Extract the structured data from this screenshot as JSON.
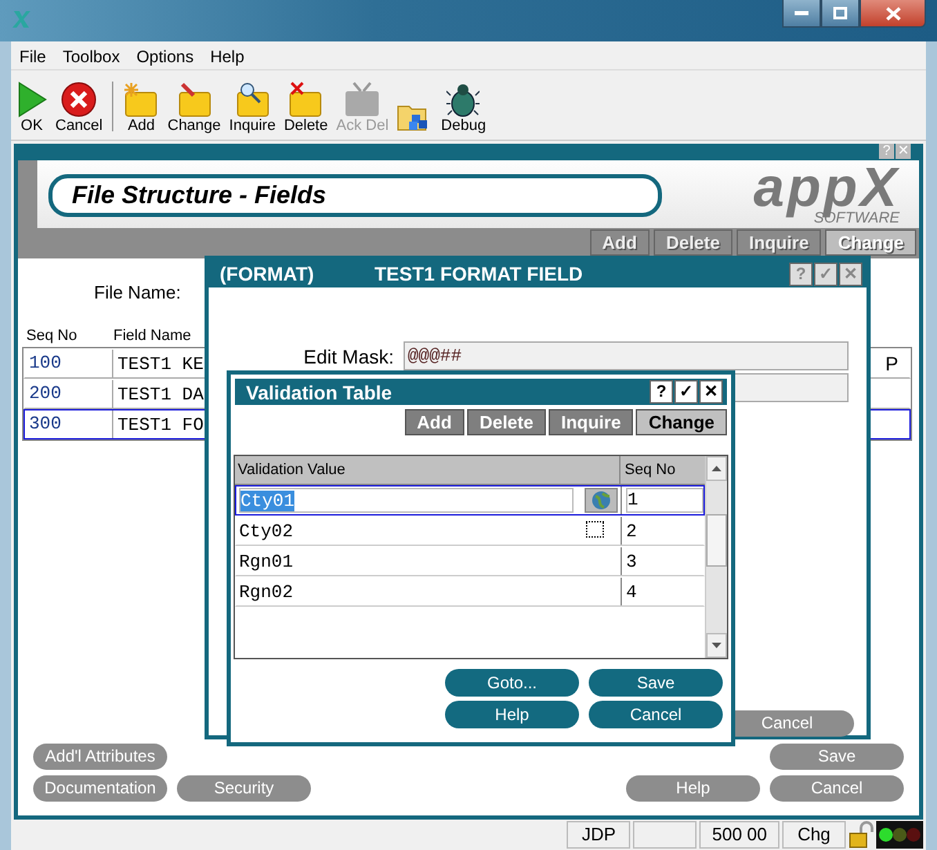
{
  "menu": [
    {
      "label": "File"
    },
    {
      "label": "Toolbox"
    },
    {
      "label": "Options"
    },
    {
      "label": "Help"
    }
  ],
  "toolbar": [
    {
      "kind": "ok",
      "label": "OK",
      "disabled": false
    },
    {
      "kind": "cancel",
      "label": "Cancel",
      "disabled": false
    },
    {
      "kind": "add",
      "label": "Add",
      "disabled": false
    },
    {
      "kind": "change",
      "label": "Change",
      "disabled": false
    },
    {
      "kind": "inquire",
      "label": "Inquire",
      "disabled": false
    },
    {
      "kind": "delete",
      "label": "Delete",
      "disabled": false
    },
    {
      "kind": "ackdel",
      "label": "Ack Del",
      "disabled": true
    },
    {
      "kind": "folder"
    },
    {
      "kind": "debug",
      "label": "Debug",
      "disabled": false
    }
  ],
  "screen": {
    "controls": [
      "?",
      "✕"
    ],
    "title": "File Structure - Fields",
    "logo": "appX",
    "logo_sub": "SOFTWARE",
    "actions": [
      {
        "label": "Add",
        "selected": false
      },
      {
        "label": "Delete",
        "selected": false
      },
      {
        "label": "Inquire",
        "selected": false
      },
      {
        "label": "Change",
        "selected": true
      }
    ],
    "file_name_label": "File Name:",
    "columns": [
      "Seq No",
      "Field Name"
    ],
    "rows": [
      {
        "seq": "100",
        "name": "TEST1 KE",
        "flag": "P",
        "selected": false
      },
      {
        "seq": "200",
        "name": "TEST1 DA",
        "selected": false
      },
      {
        "seq": "300",
        "name": "TEST1 FO",
        "selected": true
      }
    ],
    "buttons_left": [
      [
        "Add'l Attributes"
      ],
      [
        "Documentation",
        "Security"
      ]
    ],
    "buttons_right": [
      [
        "Save"
      ],
      [
        "Help",
        "Cancel"
      ]
    ]
  },
  "format_dialog": {
    "code": "(FORMAT)",
    "title": "TEST1 FORMAT FIELD",
    "controls": [
      "?",
      "✓",
      "✕"
    ],
    "edit_mask_label": "Edit Mask:",
    "edit_mask": "@@@##",
    "button": "Cancel"
  },
  "validation_dialog": {
    "title": "Validation Table",
    "controls": [
      "?",
      "✓",
      "✕"
    ],
    "actions": [
      {
        "label": "Add",
        "selected": false
      },
      {
        "label": "Delete",
        "selected": false
      },
      {
        "label": "Inquire",
        "selected": false
      },
      {
        "label": "Change",
        "selected": true
      }
    ],
    "columns": [
      "Validation Value",
      "Seq No"
    ],
    "rows": [
      {
        "value": "Cty01",
        "seq": "1",
        "selected": true,
        "marker": false
      },
      {
        "value": "Cty02",
        "seq": "2",
        "selected": false,
        "marker": true
      },
      {
        "value": "Rgn01",
        "seq": "3",
        "selected": false,
        "marker": false
      },
      {
        "value": "Rgn02",
        "seq": "4",
        "selected": false,
        "marker": false
      }
    ],
    "buttons": [
      [
        "Goto...",
        "Save"
      ],
      [
        "Help",
        "Cancel"
      ]
    ]
  },
  "status_bar": [
    {
      "kind": "text",
      "text": "JDP"
    },
    {
      "kind": "empty"
    },
    {
      "kind": "text",
      "text": "500 00"
    },
    {
      "kind": "text",
      "text": "Chg"
    }
  ]
}
